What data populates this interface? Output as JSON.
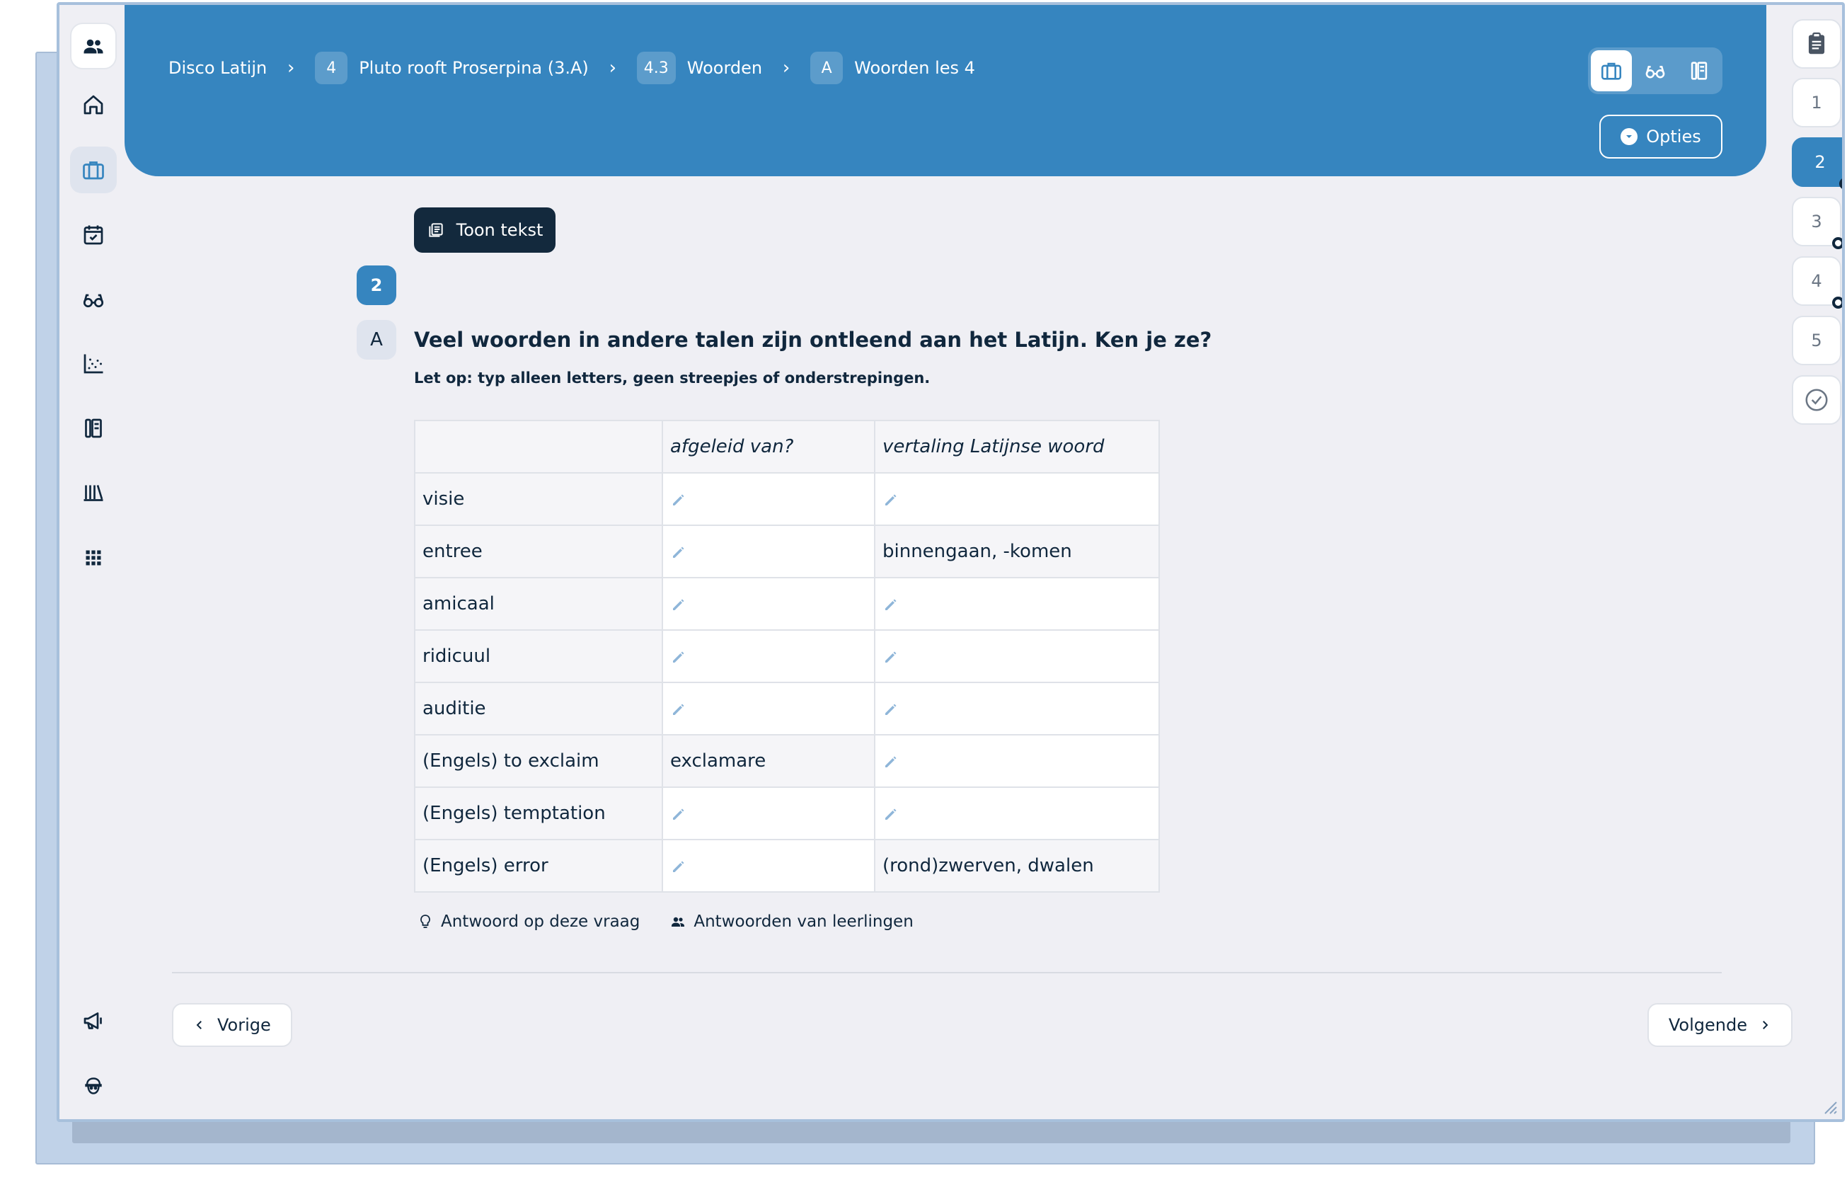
{
  "breadcrumb": [
    {
      "badge": "",
      "label": "Disco Latijn"
    },
    {
      "badge": "4",
      "label": "Pluto rooft Proserpina (3.A)"
    },
    {
      "badge": "4.3",
      "label": "Woorden"
    },
    {
      "badge": "A",
      "label": "Woorden les 4"
    }
  ],
  "breadcrumb_separator": "›",
  "header": {
    "opties_label": "Opties",
    "modes": [
      "briefcase-icon",
      "glasses-icon",
      "book-icon"
    ],
    "active_mode": "briefcase-icon"
  },
  "sidebar": {
    "items": [
      "people-icon",
      "home-icon",
      "briefcase-icon",
      "calendar-check-icon",
      "glasses-icon",
      "scatter-chart-icon",
      "book-icon",
      "library-icon",
      "apps-grid-icon",
      "megaphone-icon",
      "avatar-face-icon"
    ],
    "active": "briefcase-icon"
  },
  "rail": {
    "items": [
      {
        "label": "",
        "icon": "clipboard-icon"
      },
      {
        "label": "1"
      },
      {
        "label": "2",
        "active": true,
        "dot": true
      },
      {
        "label": "3",
        "dot": true
      },
      {
        "label": "4",
        "dot": true
      },
      {
        "label": "5"
      },
      {
        "label": "",
        "icon": "check-circle-icon"
      }
    ]
  },
  "content": {
    "toon_tekst_label": "Toon tekst",
    "question_number": "2",
    "question_part": "A",
    "question_title": "Veel woorden in andere talen zijn ontleend aan het Latijn. Ken je ze?",
    "question_note": "Let op: typ alleen letters, geen streepjes of onderstrepingen.",
    "table": {
      "headers": [
        "",
        "afgeleid van?",
        "vertaling Latijnse woord"
      ],
      "rows": [
        {
          "word": "visie",
          "afgeleid": "",
          "vertaling": ""
        },
        {
          "word": "entree",
          "afgeleid": "",
          "vertaling": "binnengaan, -komen"
        },
        {
          "word": "amicaal",
          "afgeleid": "",
          "vertaling": ""
        },
        {
          "word": "ridicuul",
          "afgeleid": "",
          "vertaling": ""
        },
        {
          "word": "auditie",
          "afgeleid": "",
          "vertaling": ""
        },
        {
          "word": "(Engels) to exclaim",
          "afgeleid": "exclamare",
          "vertaling": ""
        },
        {
          "word": "(Engels) temptation",
          "afgeleid": "",
          "vertaling": ""
        },
        {
          "word": "(Engels) error",
          "afgeleid": "",
          "vertaling": "(rond)zwerven, dwalen"
        }
      ]
    },
    "helper_answer_label": "Antwoord op deze vraag",
    "helper_students_label": "Antwoorden van leerlingen"
  },
  "footer": {
    "prev_label": "Vorige",
    "next_label": "Volgende"
  },
  "colors": {
    "header_blue": "#3685bf",
    "dark_navy": "#13293d",
    "page_bg": "#efeff4"
  }
}
